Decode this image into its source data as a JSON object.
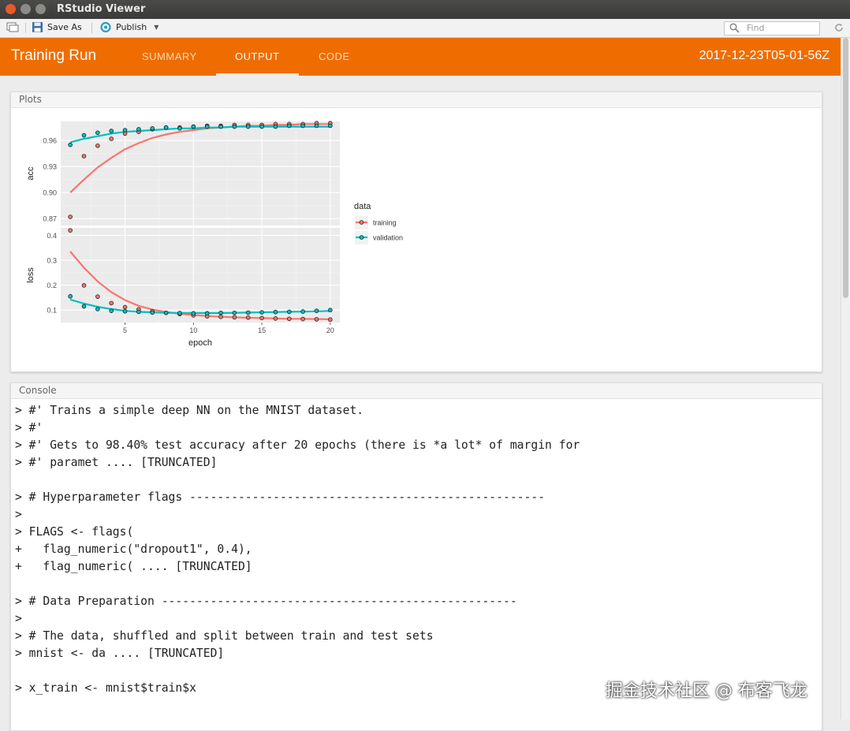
{
  "window": {
    "title": "RStudio Viewer"
  },
  "toolbar": {
    "save_as": "Save As",
    "publish": "Publish",
    "find_placeholder": "Find"
  },
  "header": {
    "brand": "Training Run",
    "tabs": [
      "SUMMARY",
      "OUTPUT",
      "CODE"
    ],
    "active_tab": "OUTPUT",
    "timestamp": "2017-12-23T05-01-56Z"
  },
  "colors": {
    "header": "#ef6d00",
    "training": "#f8766d",
    "validation": "#00bfc4",
    "panel_bg": "#ebebeb"
  },
  "plots": {
    "title": "Plots"
  },
  "console": {
    "title": "Console",
    "lines": [
      "> #' Trains a simple deep NN on the MNIST dataset.",
      "> #'",
      "> #' Gets to 98.40% test accuracy after 20 epochs (there is *a lot* of margin for",
      "> #' paramet .... [TRUNCATED]",
      "",
      "> # Hyperparameter flags ---------------------------------------------------",
      ">",
      "> FLAGS <- flags(",
      "+   flag_numeric(\"dropout1\", 0.4),",
      "+   flag_numeric( .... [TRUNCATED]",
      "",
      "> # Data Preparation ---------------------------------------------------",
      ">",
      "> # The data, shuffled and split between train and test sets",
      "> mnist <- da .... [TRUNCATED]",
      "",
      "> x_train <- mnist$train$x"
    ]
  },
  "watermark": "掘金技术社区 @ 布客飞龙",
  "chart_data": {
    "type": "scatter",
    "xlabel": "epoch",
    "legend_title": "data",
    "legend_position": "right",
    "x_ticks": [
      5,
      10,
      15,
      20
    ],
    "facets": [
      {
        "ylabel": "acc",
        "ylim": [
          0.862,
          0.982
        ],
        "y_ticks": [
          "0.87",
          "0.90",
          "0.93",
          "0.96"
        ],
        "y_tick_values": [
          0.87,
          0.9,
          0.93,
          0.96
        ],
        "series": [
          {
            "name": "training",
            "x": [
              1,
              2,
              3,
              4,
              5,
              6,
              7,
              8,
              9,
              10,
              11,
              12,
              13,
              14,
              15,
              16,
              17,
              18,
              19,
              20
            ],
            "y": [
              0.872,
              0.942,
              0.954,
              0.962,
              0.968,
              0.97,
              0.973,
              0.975,
              0.975,
              0.976,
              0.977,
              0.977,
              0.978,
              0.978,
              0.978,
              0.979,
              0.979,
              0.979,
              0.98,
              0.98
            ],
            "smooth": [
              0.9,
              0.915,
              0.929,
              0.94,
              0.95,
              0.957,
              0.963,
              0.967,
              0.97,
              0.972,
              0.974,
              0.975,
              0.976,
              0.977,
              0.977,
              0.978,
              0.978,
              0.979,
              0.979,
              0.979
            ]
          },
          {
            "name": "validation",
            "x": [
              1,
              2,
              3,
              4,
              5,
              6,
              7,
              8,
              9,
              10,
              11,
              12,
              13,
              14,
              15,
              16,
              17,
              18,
              19,
              20
            ],
            "y": [
              0.955,
              0.966,
              0.969,
              0.971,
              0.972,
              0.973,
              0.974,
              0.975,
              0.974,
              0.976,
              0.976,
              0.976,
              0.976,
              0.976,
              0.976,
              0.976,
              0.977,
              0.977,
              0.977,
              0.977
            ],
            "smooth": [
              0.958,
              0.962,
              0.965,
              0.968,
              0.97,
              0.971,
              0.972,
              0.973,
              0.974,
              0.974,
              0.975,
              0.975,
              0.976,
              0.976,
              0.976,
              0.976,
              0.976,
              0.976,
              0.976,
              0.976
            ]
          }
        ]
      },
      {
        "ylabel": "loss",
        "ylim": [
          0.05,
          0.43
        ],
        "y_ticks": [
          "0.1",
          "0.2",
          "0.3",
          "0.4"
        ],
        "y_tick_values": [
          0.1,
          0.2,
          0.3,
          0.4
        ],
        "series": [
          {
            "name": "training",
            "x": [
              1,
              2,
              3,
              4,
              5,
              6,
              7,
              8,
              9,
              10,
              11,
              12,
              13,
              14,
              15,
              16,
              17,
              18,
              19,
              20
            ],
            "y": [
              0.42,
              0.199,
              0.154,
              0.128,
              0.112,
              0.103,
              0.095,
              0.089,
              0.084,
              0.079,
              0.075,
              0.073,
              0.071,
              0.07,
              0.068,
              0.066,
              0.065,
              0.064,
              0.063,
              0.062
            ],
            "smooth": [
              0.335,
              0.27,
              0.215,
              0.172,
              0.14,
              0.117,
              0.102,
              0.092,
              0.085,
              0.08,
              0.076,
              0.073,
              0.071,
              0.069,
              0.068,
              0.066,
              0.065,
              0.065,
              0.064,
              0.063
            ]
          },
          {
            "name": "validation",
            "x": [
              1,
              2,
              3,
              4,
              5,
              6,
              7,
              8,
              9,
              10,
              11,
              12,
              13,
              14,
              15,
              16,
              17,
              18,
              19,
              20
            ],
            "y": [
              0.155,
              0.115,
              0.104,
              0.097,
              0.095,
              0.093,
              0.09,
              0.089,
              0.088,
              0.087,
              0.087,
              0.089,
              0.089,
              0.09,
              0.091,
              0.092,
              0.093,
              0.094,
              0.097,
              0.1
            ],
            "smooth": [
              0.142,
              0.126,
              0.113,
              0.104,
              0.097,
              0.093,
              0.091,
              0.089,
              0.088,
              0.088,
              0.088,
              0.088,
              0.089,
              0.09,
              0.091,
              0.092,
              0.093,
              0.094,
              0.095,
              0.097
            ]
          }
        ]
      }
    ]
  }
}
